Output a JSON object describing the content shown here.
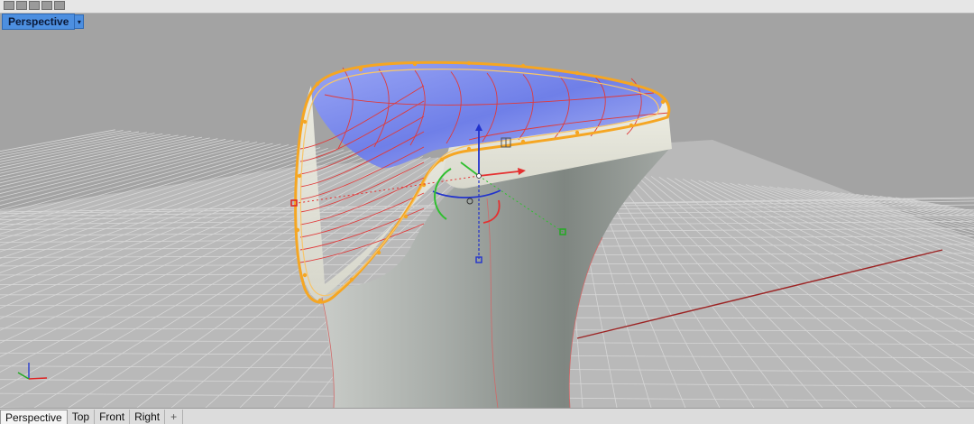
{
  "viewport": {
    "title": "Perspective",
    "menu_glyph": "▾"
  },
  "tabs": [
    {
      "label": "Perspective",
      "active": true
    },
    {
      "label": "Top",
      "active": false
    },
    {
      "label": "Front",
      "active": false
    },
    {
      "label": "Right",
      "active": false
    }
  ],
  "tab_add_glyph": "+",
  "colors": {
    "background": "#a3a3a3",
    "grid": "#d6d6d6",
    "selection_highlight": "#f5a623",
    "isocurve": "#e03a3a",
    "surface_top": "#7d8cf0",
    "gumball_x": "#e53030",
    "gumball_y": "#2fbf2f",
    "gumball_z": "#2233cc"
  },
  "icons": [
    "axes-indicator-icon",
    "gumball-icon",
    "viewport-menu-icon",
    "add-tab-icon"
  ]
}
